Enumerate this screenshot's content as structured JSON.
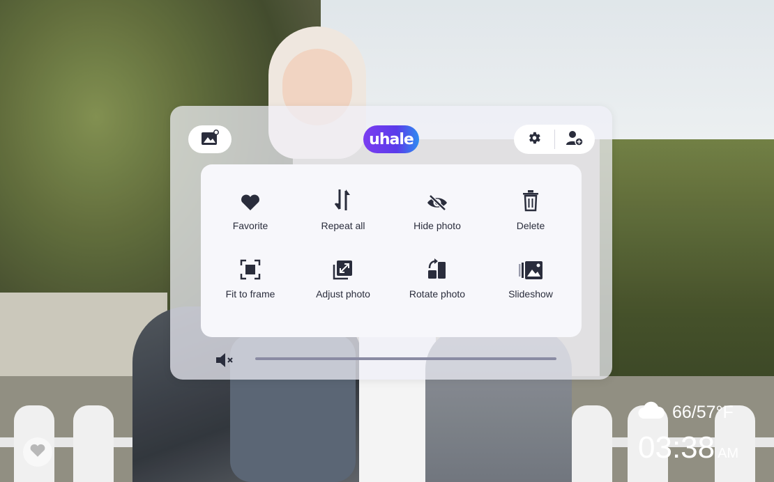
{
  "header": {
    "logo_text": "uhale"
  },
  "menu": {
    "items": [
      {
        "label": "Favorite",
        "icon": "heart-icon"
      },
      {
        "label": "Repeat all",
        "icon": "repeat-all-icon"
      },
      {
        "label": "Hide photo",
        "icon": "hide-icon"
      },
      {
        "label": "Delete",
        "icon": "trash-icon"
      },
      {
        "label": "Fit to frame",
        "icon": "fit-frame-icon"
      },
      {
        "label": "Adjust photo",
        "icon": "adjust-icon"
      },
      {
        "label": "Rotate photo",
        "icon": "rotate-icon"
      },
      {
        "label": "Slideshow",
        "icon": "slideshow-icon"
      }
    ]
  },
  "volume": {
    "muted": true,
    "level": 0
  },
  "weather": {
    "temp": "66/57°F",
    "icon": "cloud-icon"
  },
  "clock": {
    "time": "03:38",
    "ampm": "AM"
  },
  "colors": {
    "accent": "#5a3bea",
    "icon": "#2a2d3c",
    "panel": "#f7f7fb"
  }
}
